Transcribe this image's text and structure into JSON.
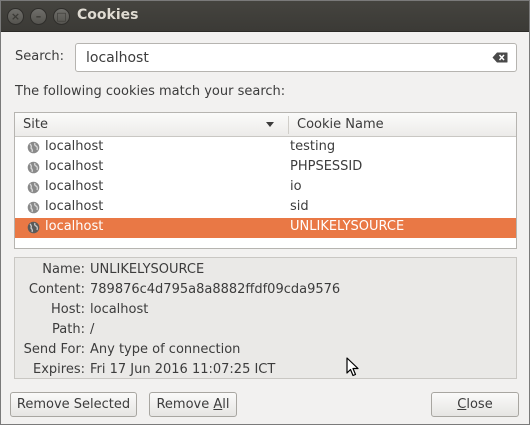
{
  "window": {
    "title": "Cookies"
  },
  "search": {
    "label": "Search:",
    "value": "localhost"
  },
  "match_text": "The following cookies match your search:",
  "list": {
    "columns": {
      "site": "Site",
      "cookie_name": "Cookie Name"
    },
    "rows": [
      {
        "site": "localhost",
        "name": "testing",
        "selected": false
      },
      {
        "site": "localhost",
        "name": "PHPSESSID",
        "selected": false
      },
      {
        "site": "localhost",
        "name": "io",
        "selected": false
      },
      {
        "site": "localhost",
        "name": "sid",
        "selected": false
      },
      {
        "site": "localhost",
        "name": "UNLIKELYSOURCE",
        "selected": true
      }
    ]
  },
  "details": {
    "name_label": "Name:",
    "name": "UNLIKELYSOURCE",
    "content_label": "Content:",
    "content": "789876c4d795a8a8882ffdf09cda9576",
    "host_label": "Host:",
    "host": "localhost",
    "path_label": "Path:",
    "path": "/",
    "send_for_label": "Send For:",
    "send_for": "Any type of connection",
    "expires_label": "Expires:",
    "expires": "Fri 17 Jun 2016 11:07:25 ICT"
  },
  "buttons": {
    "remove_selected": "Remove Selected",
    "remove_all_prefix": "Remove ",
    "remove_all_mnemonic": "A",
    "remove_all_suffix": "ll",
    "close_mnemonic": "C",
    "close_suffix": "lose"
  },
  "colors": {
    "selection": "#e97845",
    "titlebar": "#3c3b37"
  }
}
